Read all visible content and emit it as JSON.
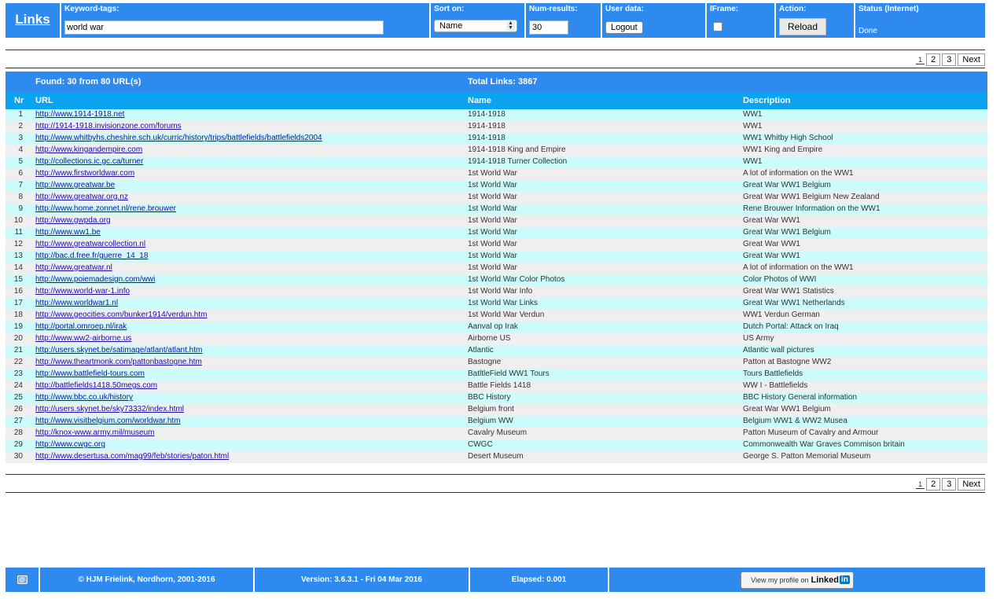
{
  "toolbar": {
    "logo": "Links",
    "keyword_label": "Keyword-tags:",
    "keyword_value": "world war",
    "sort_label": "Sort on:",
    "sort_value": "Name",
    "num_label": "Num-results:",
    "num_value": "30",
    "user_label": "User data:",
    "logout_label": "Logout",
    "iframe_label": "IFrame:",
    "iframe_checked": false,
    "action_label": "Action:",
    "reload_label": "Reload",
    "status_label": "Status (Internet)",
    "status_value": "Done"
  },
  "pager": {
    "current": "1",
    "pages": [
      "2",
      "3"
    ],
    "next_label": "Next"
  },
  "summary": {
    "found": "Found: 30 from 80 URL(s)",
    "total": "Total Links: 3867"
  },
  "columns": {
    "nr": "Nr",
    "url": "URL",
    "name": "Name",
    "description": "Description"
  },
  "rows": [
    {
      "nr": "1",
      "url": "http://www.1914-1918.net",
      "name": "1914-1918",
      "desc": "WW1"
    },
    {
      "nr": "2",
      "url": "http://1914-1918.invisionzone.com/forums",
      "name": "1914-1918",
      "desc": "WW1"
    },
    {
      "nr": "3",
      "url": "http://www.whitbyhs.cheshire.sch.uk/curric/history/trips/battlefields/battlefields2004",
      "name": "1914-1918",
      "desc": "WW1 Whitby High School"
    },
    {
      "nr": "4",
      "url": "http://www.kingandempire.com",
      "name": "1914-1918 King and Empire",
      "desc": "WW1 King and Empire"
    },
    {
      "nr": "5",
      "url": "http://collections.ic.gc.ca/turner",
      "name": "1914-1918 Turner Collection",
      "desc": "WW1"
    },
    {
      "nr": "6",
      "url": "http://www.firstworldwar.com",
      "name": "1st World War",
      "desc": "A lot of information on the WW1"
    },
    {
      "nr": "7",
      "url": "http://www.greatwar.be",
      "name": "1st World War",
      "desc": "Great War WW1 Belgium"
    },
    {
      "nr": "8",
      "url": "http://www.greatwar.org.nz",
      "name": "1st World War",
      "desc": "Great War WW1 Belgium New Zealand"
    },
    {
      "nr": "9",
      "url": "http://www.home.zonnet.nl/rene.brouwer",
      "name": "1st World War",
      "desc": "Rene Brouwer Information on the WW1"
    },
    {
      "nr": "10",
      "url": "http://www.gwpda.org",
      "name": "1st World War",
      "desc": "Great War WW1"
    },
    {
      "nr": "11",
      "url": "http://www.ww1.be",
      "name": "1st World War",
      "desc": "Great War WW1 Belgium"
    },
    {
      "nr": "12",
      "url": "http://www.greatwarcollection.nl",
      "name": "1st World War",
      "desc": "Great War WW1"
    },
    {
      "nr": "13",
      "url": "http://bac.d.free.fr/guerre_14_18",
      "name": "1st World War",
      "desc": "Great War WW1"
    },
    {
      "nr": "14",
      "url": "http://www.greatwar.nl",
      "name": "1st World War",
      "desc": "A lot of information on the WW1"
    },
    {
      "nr": "15",
      "url": "http://www.poiemadesign.com/wwi",
      "name": "1st World War Color Photos",
      "desc": "Color Photos of WWI"
    },
    {
      "nr": "16",
      "url": "http://www.world-war-1.info",
      "name": "1st World War Info",
      "desc": "Great War WW1 Statistics"
    },
    {
      "nr": "17",
      "url": "http://www.worldwar1.nl",
      "name": "1st World War Links",
      "desc": "Great War WW1 Netherlands"
    },
    {
      "nr": "18",
      "url": "http://www.geocities.com/bunker1914/verdun.htm",
      "name": "1st World War Verdun",
      "desc": "WW1 Verdun German"
    },
    {
      "nr": "19",
      "url": "http://portal.omroep.nl/irak",
      "name": "Aanval op Irak",
      "desc": "Dutch Portal: Attack on Iraq"
    },
    {
      "nr": "20",
      "url": "http://www.ww2-airborne.us",
      "name": "Airborne US",
      "desc": "US Army"
    },
    {
      "nr": "21",
      "url": "http://users.skynet.be/satimage/atlant/atlant.htm",
      "name": "Atlantic",
      "desc": "Atlantic wall pictures"
    },
    {
      "nr": "22",
      "url": "http://www.theartmonk.com/pattonbastogne.htm",
      "name": "Bastogne",
      "desc": "Patton at Bastogne WW2"
    },
    {
      "nr": "23",
      "url": "http://www.battlefield-tours.com",
      "name": "BatltleField WW1 Tours",
      "desc": "Tours Battlefields"
    },
    {
      "nr": "24",
      "url": "http://battlefields1418.50megs.com",
      "name": "Battle Fields 1418",
      "desc": "WW I - Battlefields"
    },
    {
      "nr": "25",
      "url": "http://www.bbc.co.uk/history",
      "name": "BBC History",
      "desc": "BBC History General information"
    },
    {
      "nr": "26",
      "url": "http://users.skynet.be/sky73332/index.html",
      "name": "Belgium front",
      "desc": "Great War WW1 Belgium"
    },
    {
      "nr": "27",
      "url": "http://www.visitbelgium.com/worldwar.htm",
      "name": "Belgium WW",
      "desc": "Belgium WW1 & WW2 Musea"
    },
    {
      "nr": "28",
      "url": "http://knox-www.army.mil/museum",
      "name": "Cavalry Museum",
      "desc": "Patton Museum of Cavalry and Armour"
    },
    {
      "nr": "29",
      "url": "http://www.cwgc.org",
      "name": "CWGC",
      "desc": "Commonwealth War Graves Commison britain"
    },
    {
      "nr": "30",
      "url": "http://www.desertusa.com/mag99/feb/stories/paton.html",
      "name": "Desert Museum",
      "desc": "George S. Patton Memorial Museum"
    }
  ],
  "footer": {
    "mail_icon": "@",
    "copyright": "© HJM Frielink, Nordhorn, 2001-2016",
    "version": "Version: 3.6.3.1 - Fri 04 Mar 2016",
    "elapsed": "Elapsed: 0.001",
    "linkedin_text": "View my profile on",
    "linkedin_word": "Linked",
    "linkedin_in": "in"
  },
  "colors": {
    "bar_blue": "#2f8af0",
    "header_cyan": "#0aa3f0",
    "row_odd": "#cbfbfb",
    "row_even": "#efefef",
    "link": "#1a0dab"
  }
}
